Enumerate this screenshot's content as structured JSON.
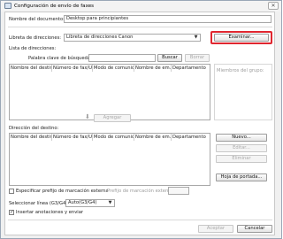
{
  "window": {
    "title": "Configuración de envío de faxes",
    "close_glyph": "✕"
  },
  "document_name": {
    "label": "Nombre del documento:",
    "value": "Desktop para principiantes"
  },
  "address_book": {
    "label": "Libreta de direcciones:",
    "selected": "Libreta de direcciones Canon",
    "browse_label": "Examinar...",
    "highlight_color": "#e0262f"
  },
  "address_list": {
    "label": "Lista de direcciones:",
    "search_label": "Palabra clave de búsqueda:",
    "search_value": "",
    "search_button": "Buscar",
    "clear_button": "Borrar",
    "columns": [
      "Nombre del destino",
      "Número de fax/URI",
      "Modo de comunic...",
      "Nombre de em...",
      "Departamento"
    ],
    "group_members_label": "Miembros del grupo:",
    "add_button": "Agregar",
    "add_arrow": "⬇"
  },
  "destination": {
    "label": "Dirección del destino:",
    "columns": [
      "Nombre del destino",
      "Número de fax/URI",
      "Modo de comunic...",
      "Nombre de em...",
      "Departamento"
    ],
    "new_button": "Nuevo...",
    "edit_button": "Editar...",
    "delete_button": "Eliminar",
    "cover_sheet_button": "Hoja de portada..."
  },
  "external_dial": {
    "checkbox_label": "Especificar prefijo de marcación externa",
    "checked": false,
    "prefix_label": "Prefijo de marcación externa:",
    "prefix_value": ""
  },
  "line": {
    "label": "Seleccionar línea (G3/G4):",
    "selected": "Auto(G3/G4)"
  },
  "annotations": {
    "checkbox_label": "Insertar anotaciones y enviar",
    "checked": true,
    "check_glyph": "✓"
  },
  "footer": {
    "accept_button": "Aceptar",
    "cancel_button": "Cancelar"
  }
}
